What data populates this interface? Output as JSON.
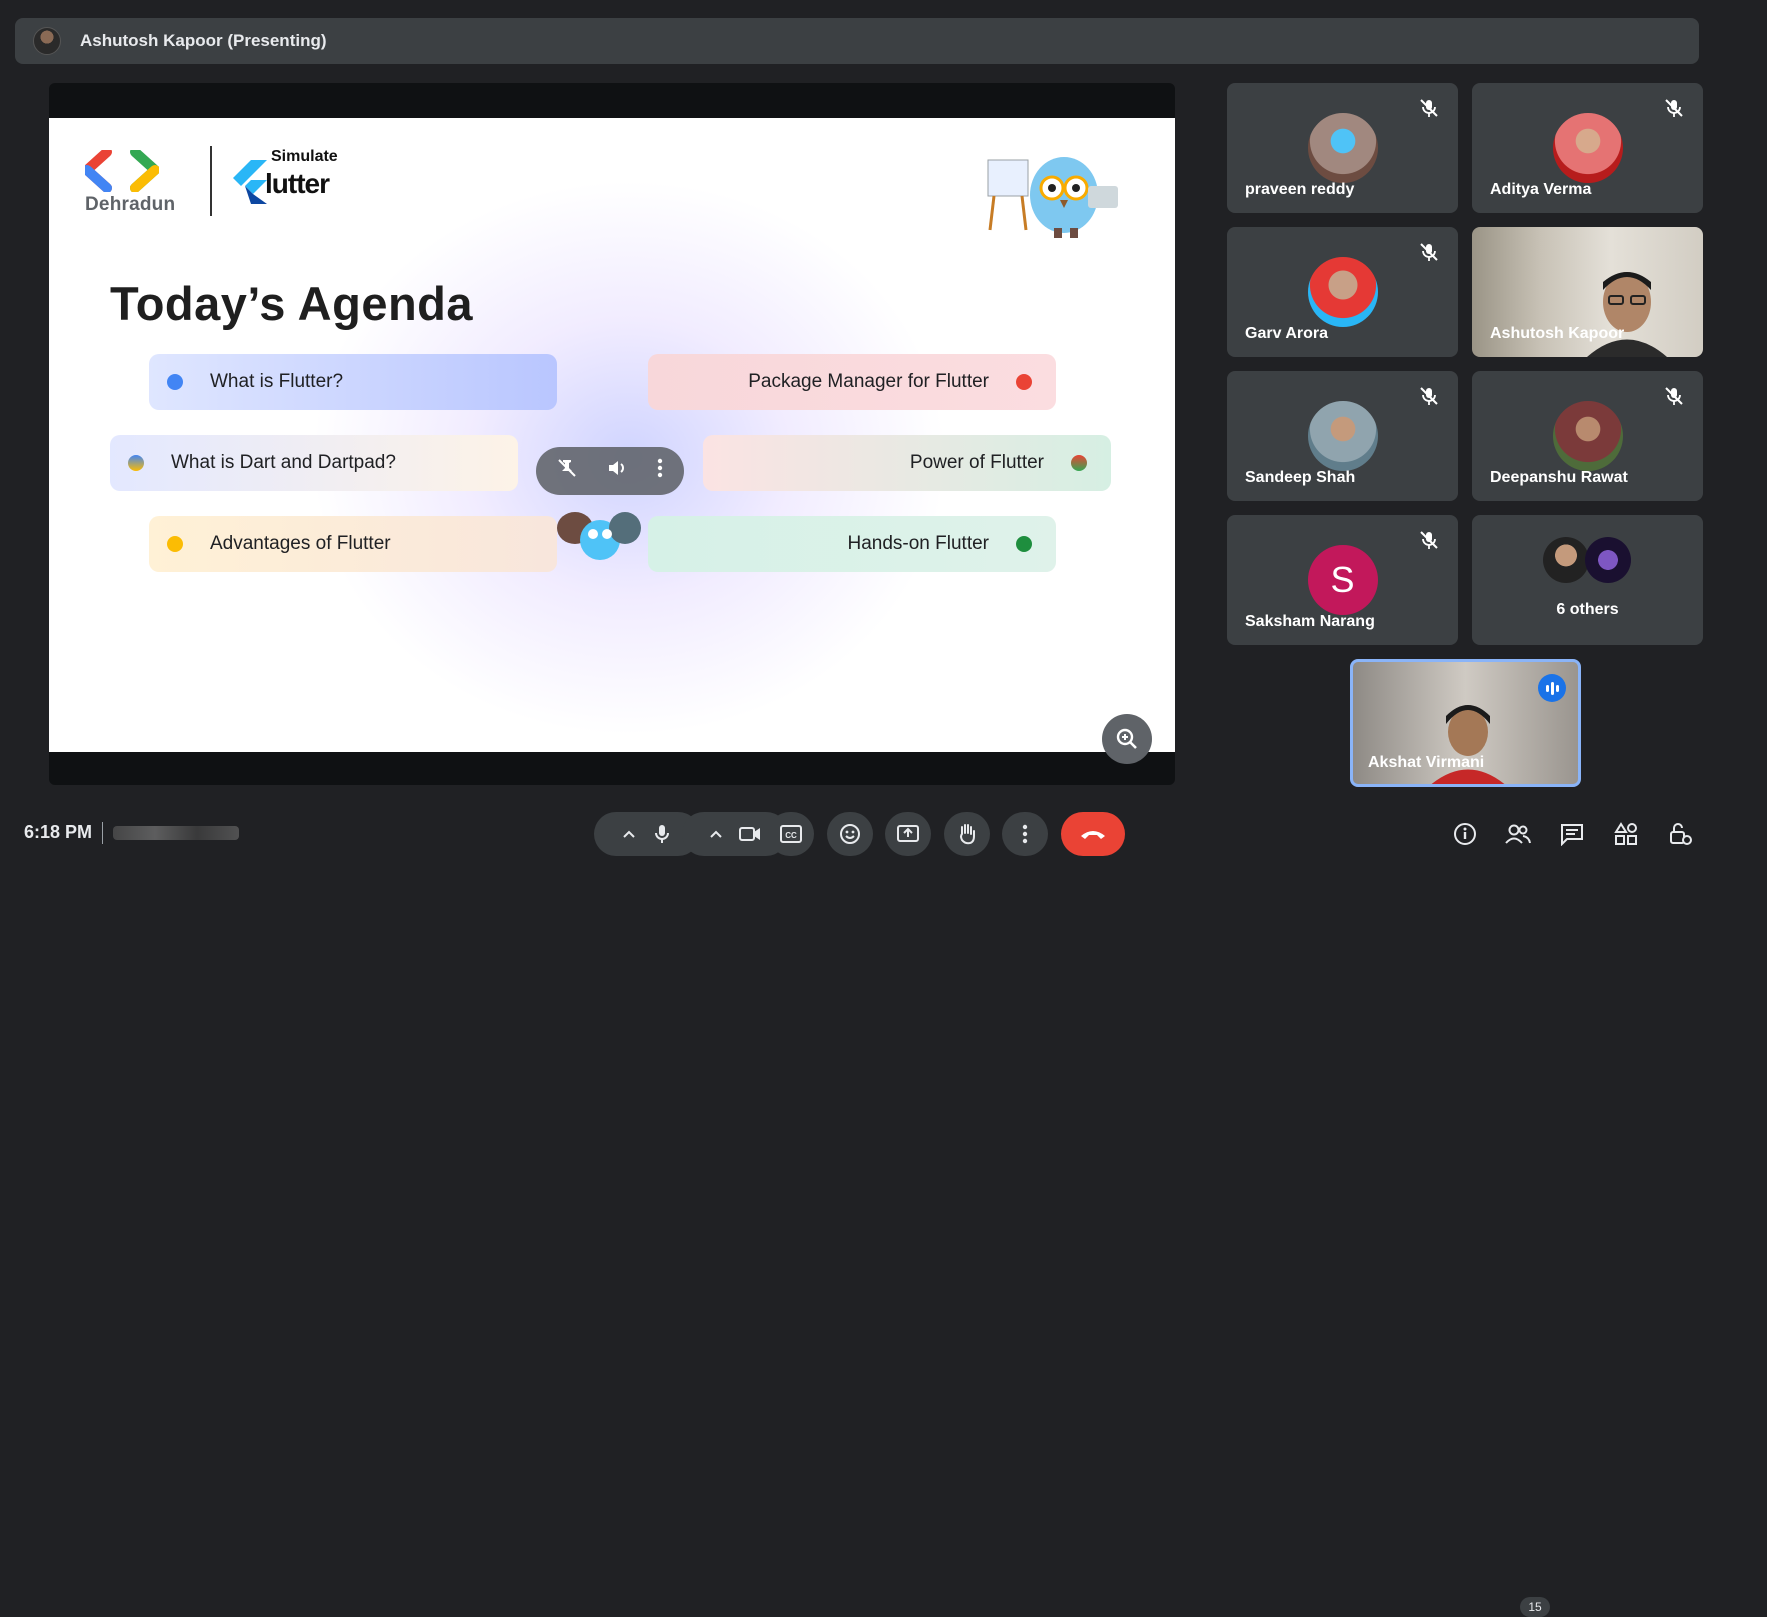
{
  "header": {
    "presenter": "Ashutosh Kapoor (Presenting)"
  },
  "slide": {
    "gdg_label": "Dehradun",
    "simulate_label": "Simulate",
    "flutter_label": "lutter",
    "title": "Today’s Agenda",
    "items": [
      {
        "label": "What is Flutter?",
        "color": "#4285f4"
      },
      {
        "label": "What is Dart and Dartpad?",
        "color": "#f9ab00"
      },
      {
        "label": "Advantages of Flutter",
        "color": "#fbbc04"
      },
      {
        "label": "Package Manager for Flutter",
        "color": "#ea4335"
      },
      {
        "label": "Power of Flutter",
        "color": "#d36b4f"
      },
      {
        "label": "Hands-on Flutter",
        "color": "#1e8e3e"
      }
    ]
  },
  "participants": [
    {
      "name": "praveen reddy",
      "muted": true
    },
    {
      "name": "Aditya Verma",
      "muted": true
    },
    {
      "name": "Garv Arora",
      "muted": true
    },
    {
      "name": "Ashutosh Kapoor",
      "muted": false
    },
    {
      "name": "Sandeep Shah",
      "muted": true
    },
    {
      "name": "Deepanshu Rawat",
      "muted": true
    },
    {
      "name": "Saksham Narang",
      "muted": true,
      "initial": "S"
    },
    {
      "name": "6 others",
      "muted": false
    }
  ],
  "self_view": {
    "name": "Akshat Virmani"
  },
  "footer": {
    "time": "6:18 PM",
    "people_count": "15"
  },
  "icons": [
    "mic-icon",
    "camera-icon",
    "captions-icon",
    "emoji-icon",
    "present-icon",
    "raise-hand-icon",
    "more-icon",
    "end-call-icon",
    "info-icon",
    "people-icon",
    "chat-icon",
    "activities-icon",
    "host-controls-icon"
  ]
}
